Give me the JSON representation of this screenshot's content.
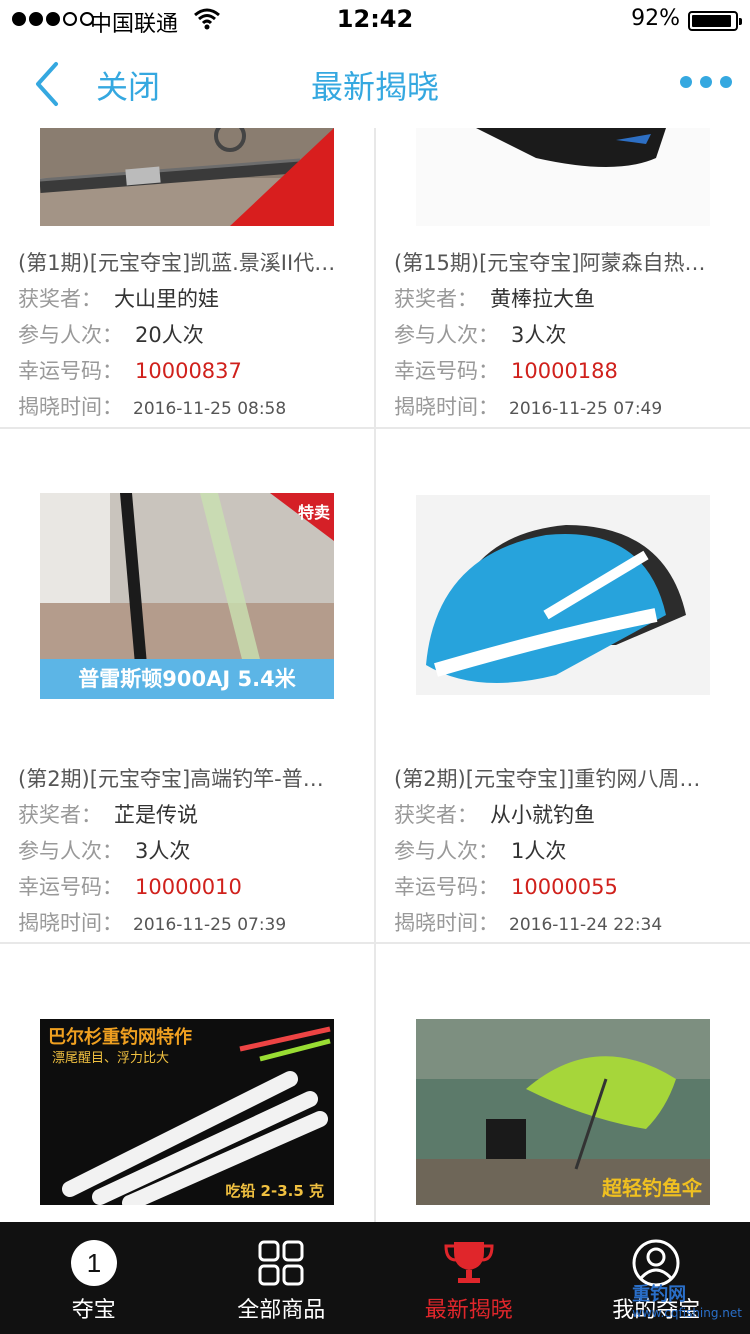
{
  "status": {
    "carrier": "中国联通",
    "time": "12:42",
    "battery": "92%"
  },
  "nav": {
    "close": "关闭",
    "title": "最新揭晓"
  },
  "labels": {
    "winner": "获奖者：",
    "participants": "参与人次：",
    "lucky_number": "幸运号码：",
    "reveal_time": "揭晓时间："
  },
  "items": [
    {
      "title": "(第1期)[元宝夺宝]凯蓝.景溪II代…",
      "winner": "大山里的娃",
      "participants": "20人次",
      "lucky_number": "10000837",
      "reveal_time": "2016-11-25 08:58",
      "banner": ""
    },
    {
      "title": "(第15期)[元宝夺宝]阿蒙森自热…",
      "winner": "黄棒拉大鱼",
      "participants": "3人次",
      "lucky_number": "10000188",
      "reveal_time": "2016-11-25 07:49",
      "banner": ""
    },
    {
      "title": "(第2期)[元宝夺宝]高端钓竿-普…",
      "winner": "芷是传说",
      "participants": "3人次",
      "lucky_number": "10000010",
      "reveal_time": "2016-11-25 07:39",
      "banner": "普雷斯顿900AJ 5.4米",
      "corner_tag": "特卖"
    },
    {
      "title": "(第2期)[元宝夺宝]]重钓网八周…",
      "winner": "从小就钓鱼",
      "participants": "1人次",
      "lucky_number": "10000055",
      "reveal_time": "2016-11-24 22:34",
      "banner": ""
    },
    {
      "banner": "巴尔杉重钓网特作",
      "banner_sub": "漂尾醒目、浮力比大",
      "banner_bottom": "吃铅 2-3.5 克"
    },
    {
      "banner": "超轻钓鱼伞"
    }
  ],
  "tabs": [
    {
      "label": "夺宝",
      "icon": "number-one-circle-icon"
    },
    {
      "label": "全部商品",
      "icon": "grid-icon"
    },
    {
      "label": "最新揭晓",
      "icon": "trophy-icon",
      "active": true
    },
    {
      "label": "我的夺宝",
      "icon": "user-circle-icon"
    }
  ],
  "watermark": {
    "brand": "重钓网",
    "url": "www.cqfishing.net"
  },
  "colors": {
    "accent": "#35a8e0",
    "lucky": "#d0211c",
    "tab_active": "#e0262b"
  }
}
